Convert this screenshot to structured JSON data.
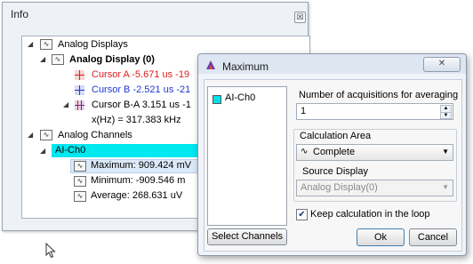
{
  "info_window": {
    "title": "Info",
    "close_glyph": "☒",
    "tree": {
      "analog_displays_label": "Analog Displays",
      "analog_display_0_label": "Analog Display (0)",
      "cursor_a": "Cursor A  -5.671 us  -19",
      "cursor_b": "Cursor B  -2.521 us  -21",
      "cursor_ba": "Cursor B-A  3.151 us  -1",
      "freq": "x(Hz) = 317.383 kHz",
      "analog_channels_label": "Analog Channels",
      "ai_ch0_label": "AI-Ch0",
      "maximum": "Maximum:  909.424 mV",
      "minimum": "Minimum:  -909.546 m",
      "average": "Average:  268.631 uV"
    },
    "colors": {
      "cursor_a": "#e21b1b",
      "cursor_b": "#2037d6",
      "highlight": "#00e8f0"
    }
  },
  "maximum_dialog": {
    "title": "Maximum",
    "close_glyph": "☒",
    "channels": [
      "AI-Ch0"
    ],
    "select_channels_label": "Select Channels",
    "acq_label": "Number of acquisitions for averaging",
    "acq_value": "1",
    "calc_area_label": "Calculation Area",
    "calc_area_value": "Complete",
    "source_display_label": "Source Display",
    "source_display_value": "Analog Display(0)",
    "keep_label": "Keep calculation in the loop",
    "keep_checked": true,
    "ok_label": "Ok",
    "cancel_label": "Cancel"
  },
  "icons": [
    "wave-icon",
    "cursor-icon",
    "checkbox-icon",
    "mouse-pointer-icon",
    "dialog-app-icon"
  ]
}
